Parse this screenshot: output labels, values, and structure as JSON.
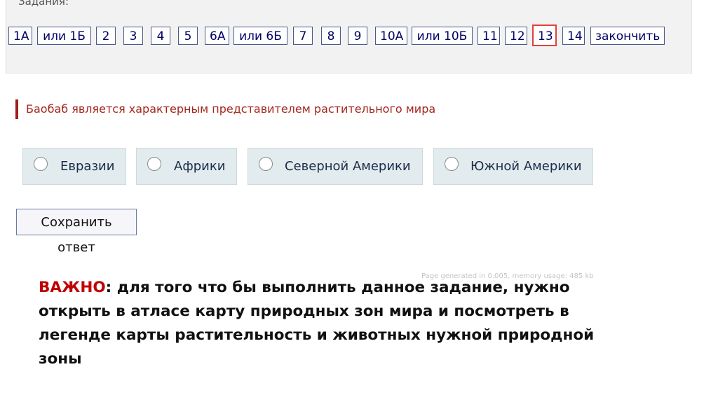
{
  "tasks": {
    "label": "Задания:",
    "buttons": [
      "1А",
      "или 1Б",
      "2",
      "3",
      "4",
      "5",
      "6А",
      "или 6Б",
      "7",
      "8",
      "9",
      "10А",
      "или 10Б",
      "11",
      "12",
      "13",
      "14",
      "закончить"
    ],
    "active": "13"
  },
  "question": {
    "text": "Баобаб является характерным представителем растительного мира"
  },
  "options": [
    "Евразии",
    "Африки",
    "Северной Америки",
    "Южной Америки"
  ],
  "save_button": "Сохранить ответ",
  "page_stats": "Page generated in 0.005, memory usage: 485 kb",
  "note": {
    "important": "ВАЖНО",
    "text": ": для того что бы выполнить данное задание, нужно открыть в атласе карту природных зон мира и посмотреть в легенде карты растительность и животных нужной природной зоны"
  },
  "colors": {
    "active_border": "#e0413c",
    "question_text": "#a3261e",
    "important": "#c00000",
    "option_bg": "#e2ecee"
  }
}
